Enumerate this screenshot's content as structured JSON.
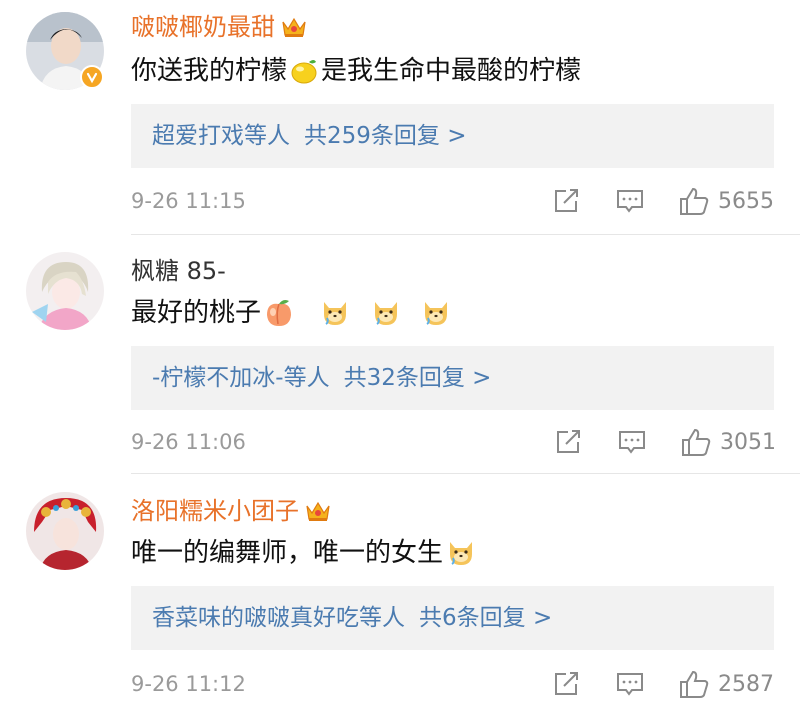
{
  "comments": [
    {
      "username": "啵啵椰奶最甜",
      "content_text": "你送我的柠檬",
      "content_emoji": "lemon-emoji",
      "content_text_2": "是我生命中最酸的柠檬",
      "reply_users": "超爱打戏等人",
      "reply_count": "共259条回复 >",
      "time": "9-26 11:15",
      "likes": "5655"
    },
    {
      "username": "枫糖 85-",
      "content_text": "最好的桃子",
      "content_emoji": "peach-emoji",
      "reply_users": "-柠檬不加冰-等人",
      "reply_count": "共32条回复 >",
      "time": "9-26 11:06",
      "likes": "3051"
    },
    {
      "username": "洛阳糯米小团子",
      "content_text": "唯一的编舞师，唯一的女生",
      "content_emoji": "dog-emoji",
      "reply_users": "香菜味的啵啵真好吃等人",
      "reply_count": "共6条回复 >",
      "time": "9-26 11:12",
      "likes": "2587"
    }
  ],
  "colors": {
    "vip_name": "#e8722a",
    "reply_link": "#4b7bb0",
    "reply_bg": "#f2f2f2",
    "meta": "#9a9a9a"
  }
}
